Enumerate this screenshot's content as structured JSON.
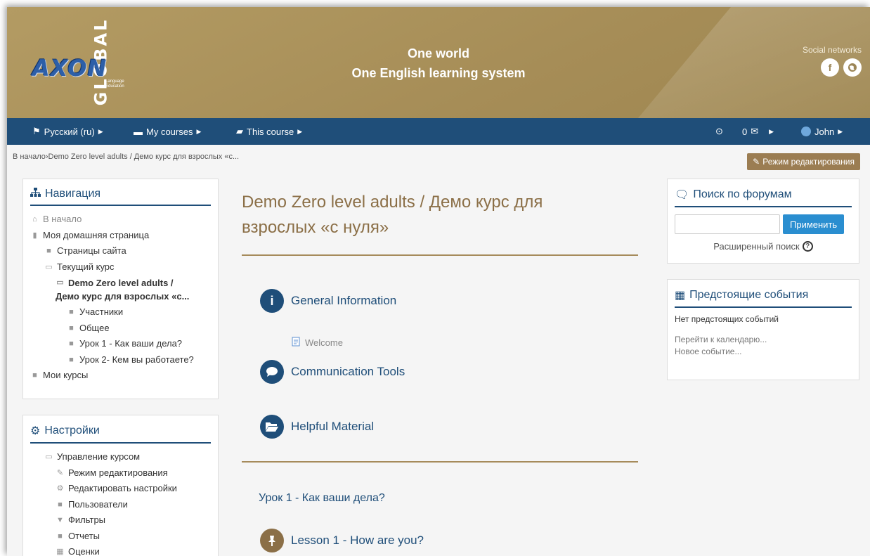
{
  "header": {
    "logo": {
      "global_text": "GLOBAL",
      "brand": "AXON",
      "sub_line1": "Language",
      "sub_line2": "Education"
    },
    "tagline_1": "One world",
    "tagline_2": "One English learning system",
    "social_label": "Social networks",
    "social_icons": [
      "facebook-icon",
      "globe-icon"
    ]
  },
  "navbar": {
    "language": "Русский (ru)",
    "my_courses": "My courses",
    "this_course": "This course",
    "messages_count": "0",
    "user": "John"
  },
  "breadcrumb": {
    "home": "В начало",
    "separator": "›",
    "current": "Demo Zero level adults / Демо курс для взрослых «с..."
  },
  "edit_button": "Режим редактирования",
  "navigation_block": {
    "title": "Навигация",
    "items": [
      {
        "label": "В начало"
      },
      {
        "label": "Моя домашняя страница"
      },
      {
        "label": "Страницы сайта"
      },
      {
        "label": "Текущий курс"
      },
      {
        "label_line1": "Demo Zero level adults /",
        "label_line2": "Демо курс для взрослых «с..."
      },
      {
        "label": "Участники"
      },
      {
        "label": "Общее"
      },
      {
        "label": "Урок 1 - Как ваши дела?"
      },
      {
        "label": "Урок 2- Кем вы работаете?"
      },
      {
        "label": "Мои курсы"
      }
    ]
  },
  "settings_block": {
    "title": "Настройки",
    "items": [
      {
        "label": "Управление курсом"
      },
      {
        "label": "Режим редактирования"
      },
      {
        "label": "Редактировать настройки"
      },
      {
        "label": "Пользователи"
      },
      {
        "label": "Фильтры"
      },
      {
        "label": "Отчеты"
      },
      {
        "label": "Оценки"
      }
    ]
  },
  "main": {
    "course_title_line1": "Demo Zero level adults / Демо курс для",
    "course_title_line2": "взрослых «с нуля»",
    "sections": [
      {
        "label": "General Information",
        "icon": "info-icon"
      },
      {
        "label": "Communication Tools",
        "icon": "chat-icon"
      },
      {
        "label": "Helpful Material",
        "icon": "folder-open-icon"
      }
    ],
    "activity_welcome": "Welcome",
    "lesson_section_title": "Урок 1 - Как ваши дела?",
    "lesson_item": "Lesson 1 - How are you?"
  },
  "forum_search_block": {
    "title": "Поиск по форумам",
    "input_value": "",
    "apply_button": "Применить",
    "advanced_search": "Расширенный поиск"
  },
  "events_block": {
    "title": "Предстоящие события",
    "no_events": "Нет предстоящих событий",
    "goto_calendar": "Перейти к календарю...",
    "new_event": "Новое событие..."
  },
  "colors": {
    "header_gold": "#a68d57",
    "navbar_blue": "#1f4e79",
    "title_brown": "#8b6f47",
    "button_blue": "#2a8ed0",
    "edit_button_brown": "#9b7d52"
  }
}
